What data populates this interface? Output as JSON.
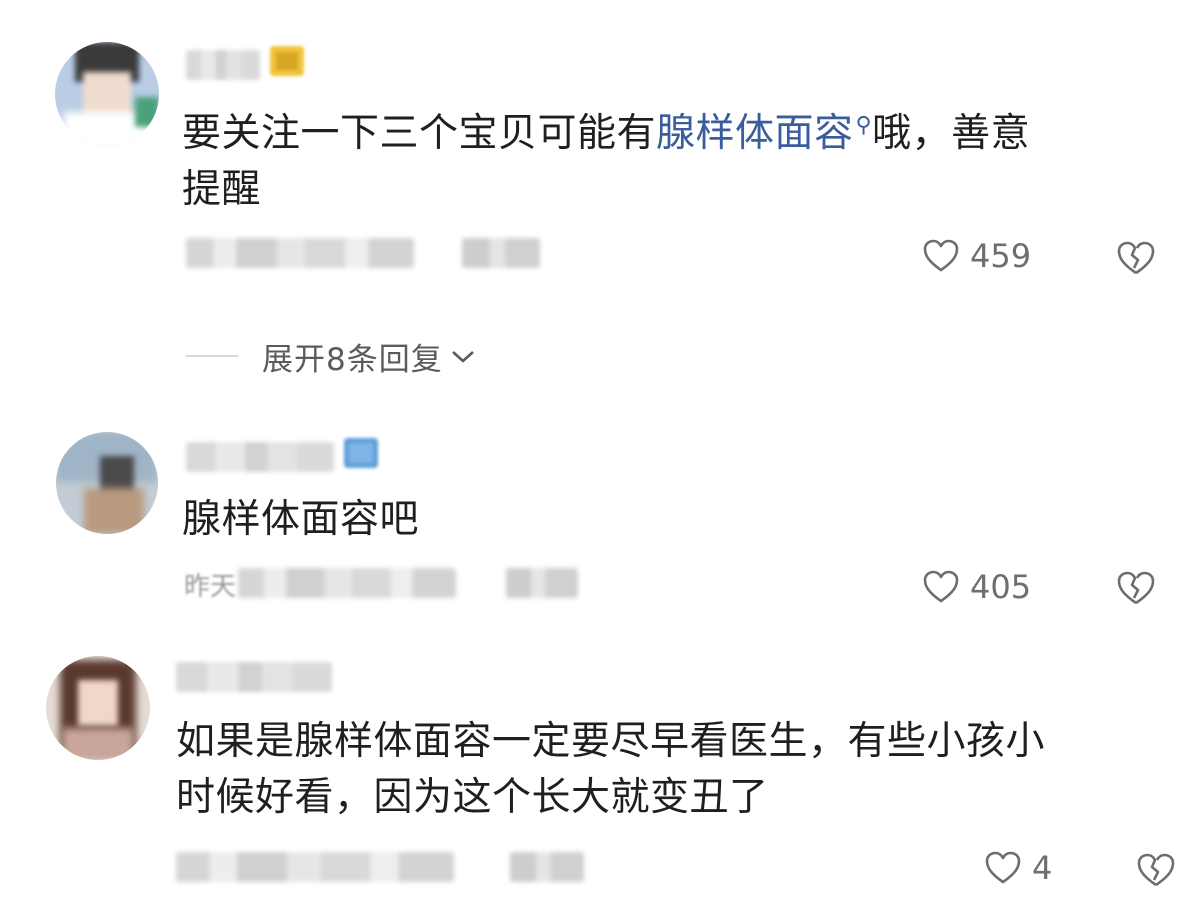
{
  "comments": [
    {
      "text_lines": [
        "要关注一下三个宝贝可能有",
        "提醒"
      ],
      "keyword": "腺样体面容",
      "after_keyword": "哦，善意",
      "search_icon": "search-icon",
      "likes": "459",
      "badge_color": "#c99a1d"
    },
    {
      "text": "腺样体面容吧",
      "meta_prefix": "昨天",
      "likes": "405",
      "badge_color": "#5f9fd8"
    },
    {
      "text_lines": [
        "如果是腺样体面容一定要尽早看医生，有些小孩小",
        "时候好看，因为这个长大就变丑了"
      ],
      "likes": "4"
    }
  ],
  "replies_toggle": {
    "label": "展开8条回复",
    "icon": "chevron-down-icon"
  },
  "icons": {
    "like": "heart-outline-icon",
    "dislike": "broken-heart-icon"
  },
  "colors": {
    "keyword": "#3b5d9c",
    "meta": "#9a9a9a",
    "text": "#1f1f1f"
  }
}
